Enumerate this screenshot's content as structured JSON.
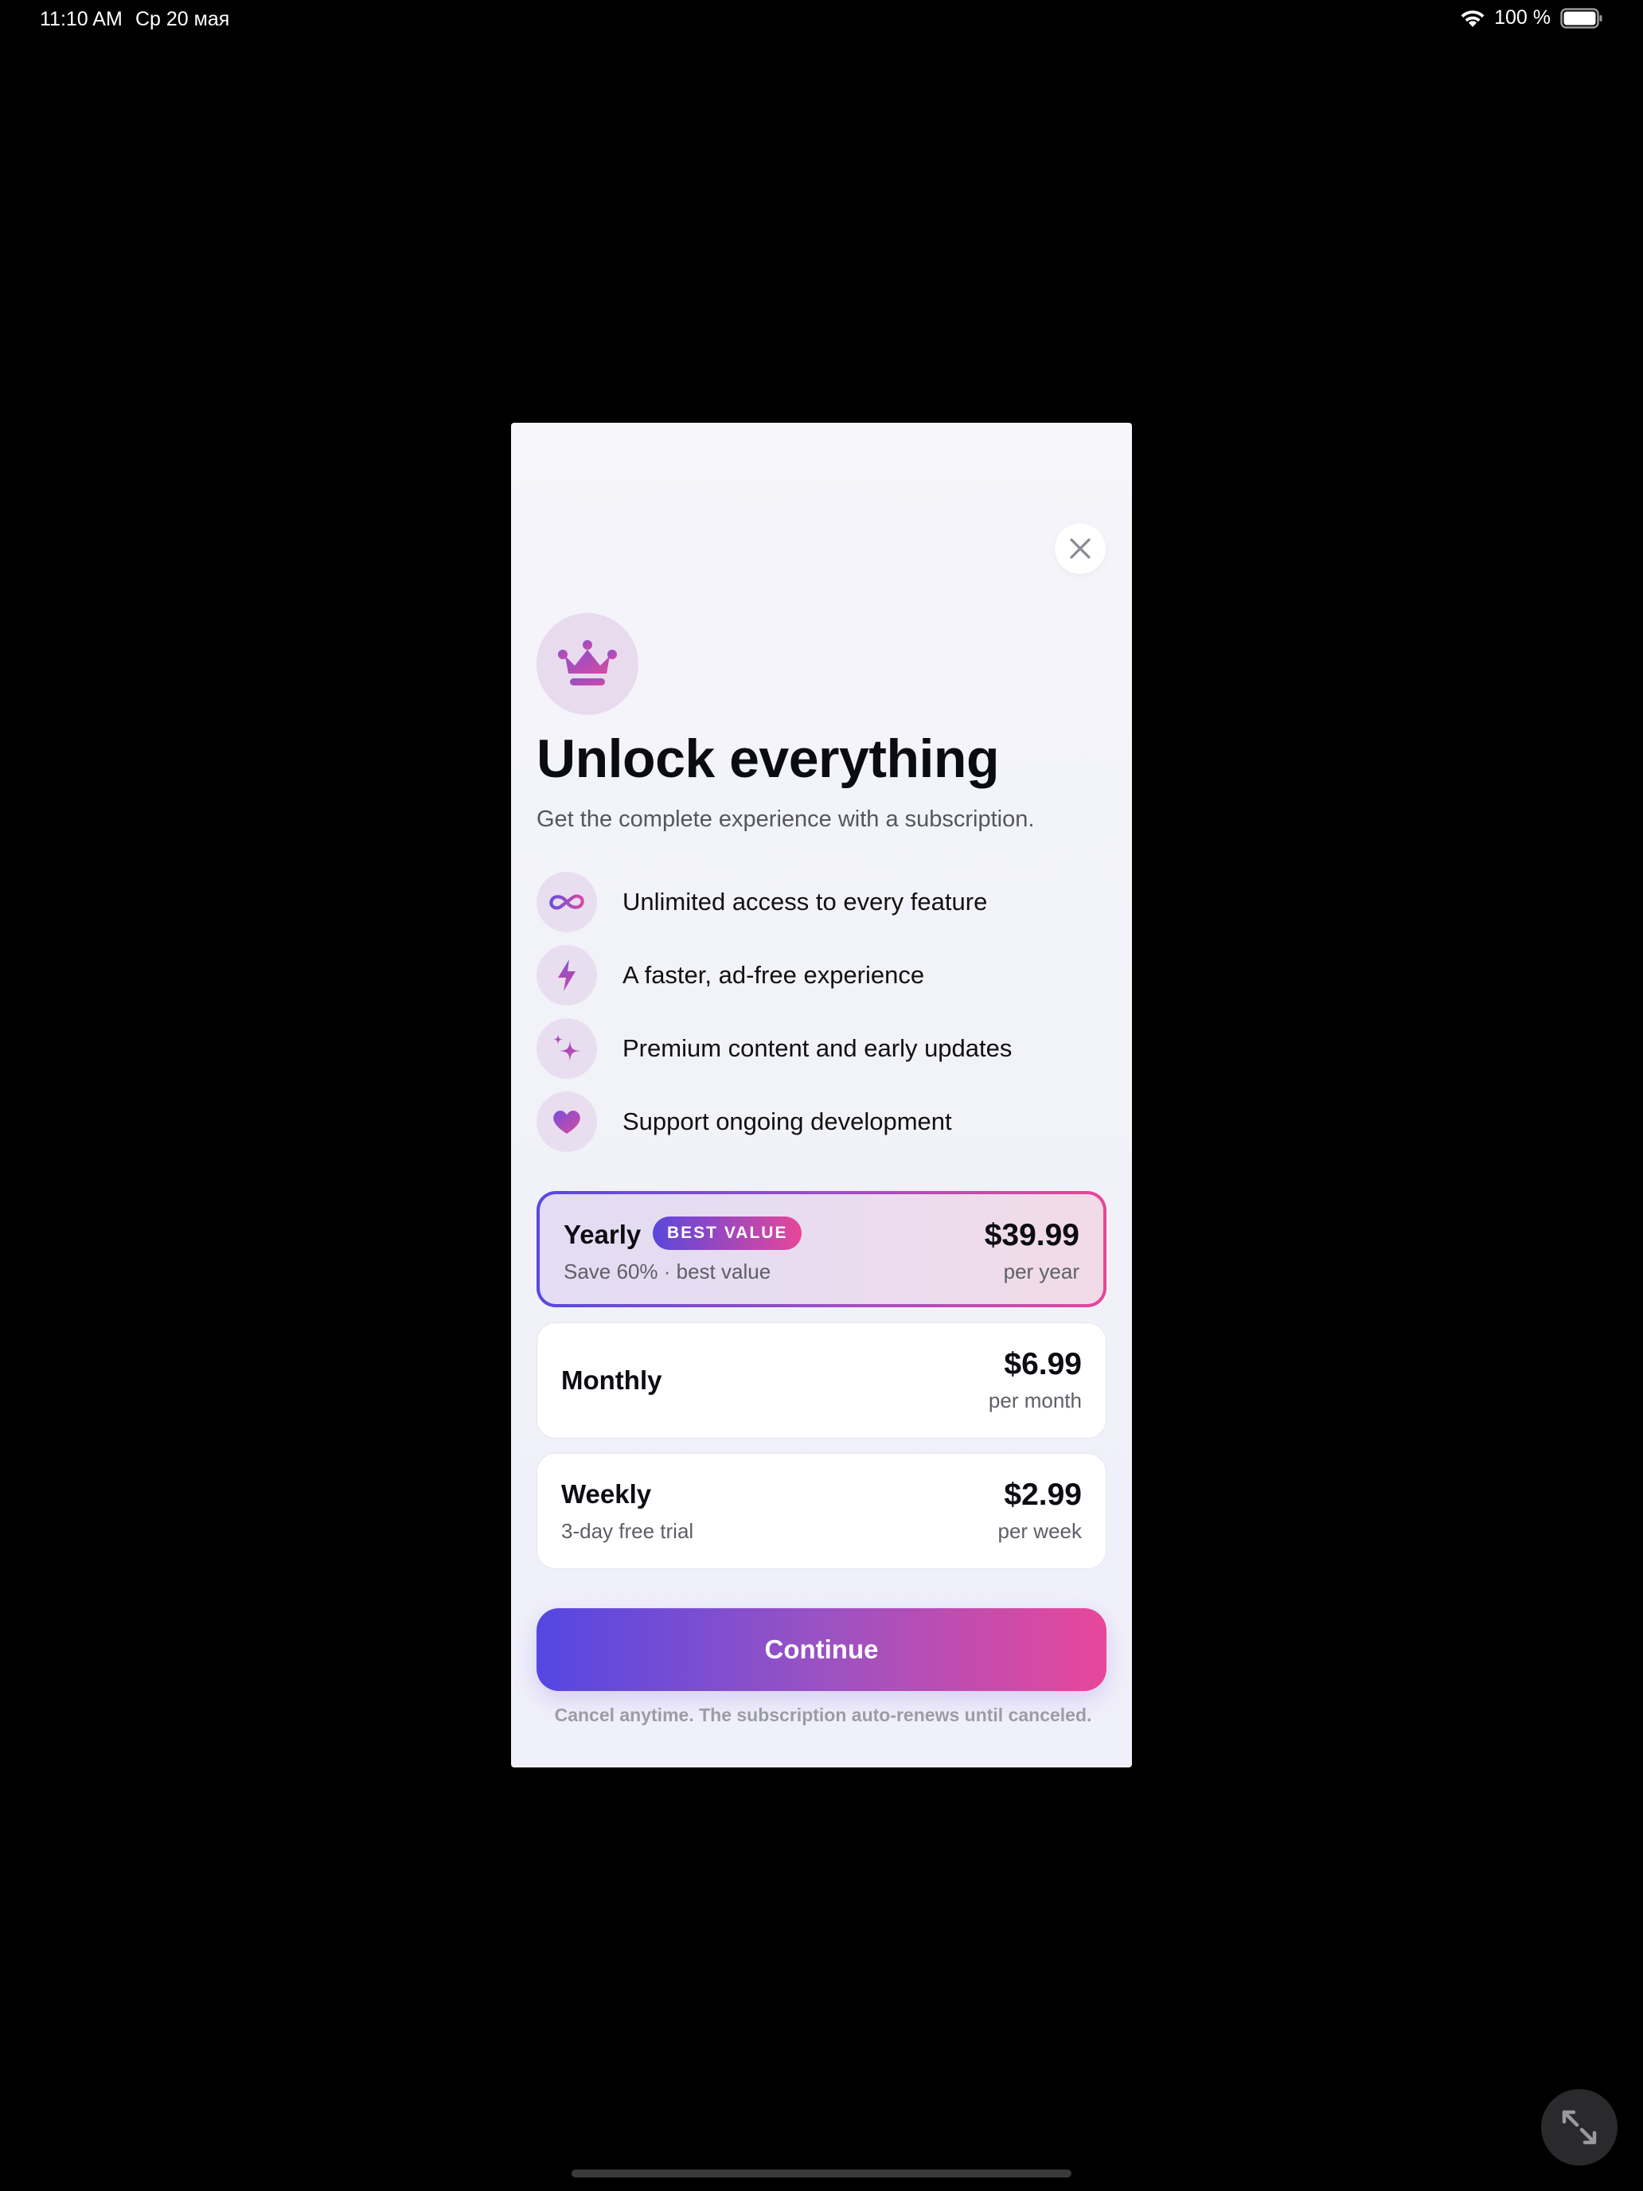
{
  "status_bar": {
    "time": "11:10 AM",
    "date": "Ср 20 мая",
    "battery_text": "100 %",
    "icons": [
      "wifi-icon",
      "battery-icon"
    ]
  },
  "paywall": {
    "close_icon": "close-icon",
    "hero_icon": "crown-icon",
    "title": "Unlock everything",
    "subtitle": "Get the complete experience with a subscription.",
    "features": [
      {
        "icon": "infinity-icon",
        "text": "Unlimited access to every feature"
      },
      {
        "icon": "bolt-icon",
        "text": "A faster, ad-free experience"
      },
      {
        "icon": "sparkles-icon",
        "text": "Premium content and early updates"
      },
      {
        "icon": "heart-icon",
        "text": "Support ongoing development"
      }
    ],
    "plans": [
      {
        "name": "Yearly",
        "badge": "BEST VALUE",
        "subtitle": "Save 60% · best value",
        "price": "$39.99",
        "period": "per year",
        "selected": true
      },
      {
        "name": "Monthly",
        "subtitle": "",
        "price": "$6.99",
        "period": "per month",
        "selected": false
      },
      {
        "name": "Weekly",
        "subtitle": "3-day free trial",
        "price": "$2.99",
        "period": "per week",
        "selected": false
      }
    ],
    "continue_label": "Continue",
    "footnote": "Cancel anytime. The subscription auto-renews until canceled."
  },
  "colors": {
    "accent_start": "#5447e2",
    "accent_end": "#e8479a",
    "icon_purple": "#8a4fd0",
    "icon_pink": "#d64aa0"
  },
  "resize_icon": "expand-arrows-icon"
}
